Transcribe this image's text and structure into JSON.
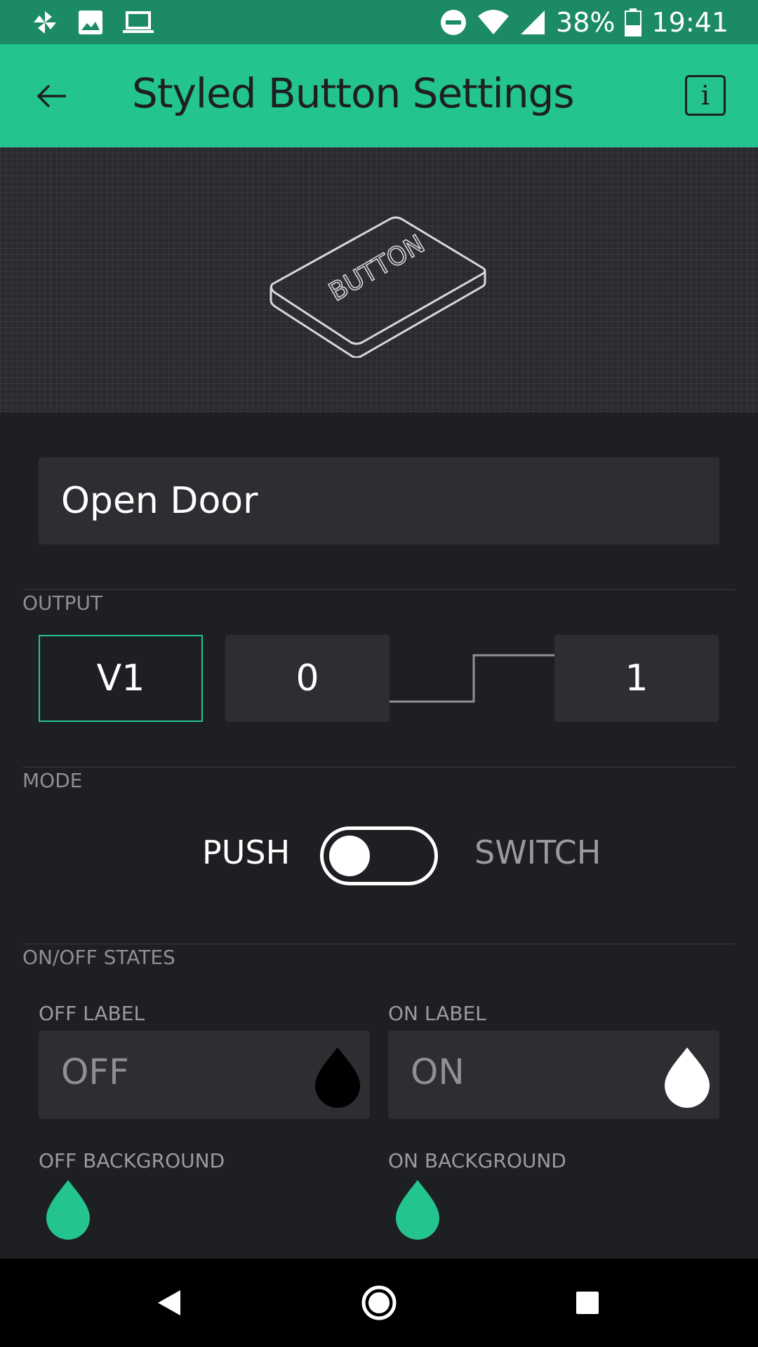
{
  "status_bar": {
    "battery": "38%",
    "time": "19:41",
    "icons": [
      "pinwheel-icon",
      "image-icon",
      "laptop-icon",
      "do-not-disturb-icon",
      "wifi-icon",
      "cell-signal-icon",
      "battery-icon"
    ]
  },
  "app_bar": {
    "title": "Styled Button Settings",
    "back_icon": "arrow-left-icon",
    "info_label": "i"
  },
  "preview": {
    "button_text": "BUTTON"
  },
  "name_field": {
    "value": "Open Door"
  },
  "output": {
    "section_label": "OUTPUT",
    "pin": "V1",
    "low_value": "0",
    "high_value": "1"
  },
  "mode": {
    "section_label": "MODE",
    "push_label": "PUSH",
    "switch_label": "SWITCH",
    "toggle_state": "push"
  },
  "states": {
    "section_label": "ON/OFF STATES",
    "off_label_title": "OFF LABEL",
    "off_label_value": "OFF",
    "off_label_color": "#000000",
    "on_label_title": "ON LABEL",
    "on_label_value": "ON",
    "on_label_color": "#ffffff",
    "off_background_title": "OFF BACKGROUND",
    "off_background_color": "#23c48e",
    "on_background_title": "ON BACKGROUND",
    "on_background_color": "#23c48e"
  },
  "colors": {
    "accent": "#23c48e",
    "status_bar": "#1c8b63",
    "background": "#1e1f22"
  },
  "nav_bar": {
    "icons": [
      "back-triangle-icon",
      "home-circle-icon",
      "recents-square-icon"
    ]
  }
}
